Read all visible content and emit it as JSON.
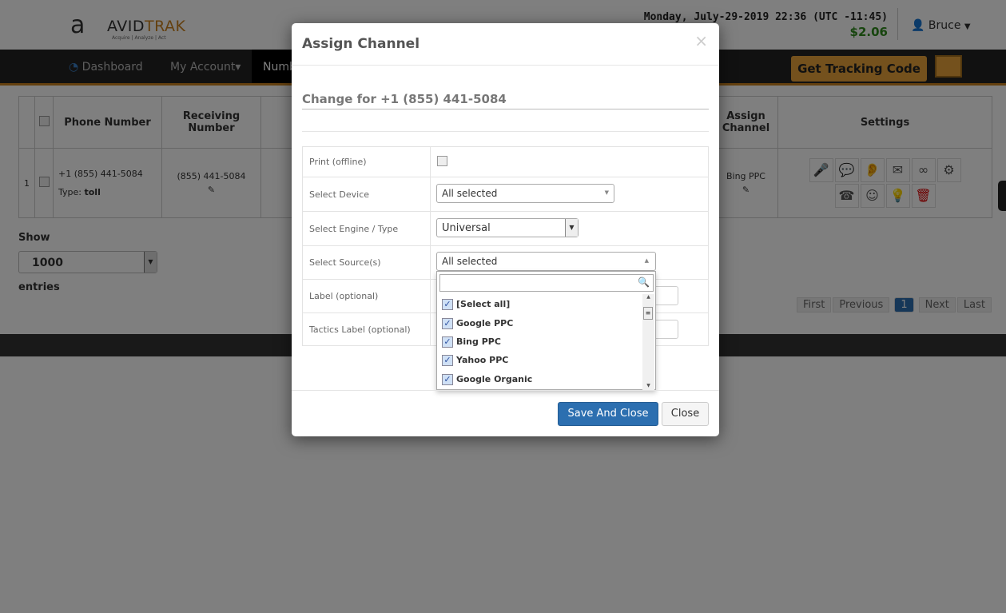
{
  "header": {
    "logo_mark": "a",
    "logo_text_a": "AVID",
    "logo_text_b": "TRAK",
    "tagline": "Acquire | Analyze | Act",
    "datetime": "Monday, July-29-2019 22:36 (UTC -11:45)",
    "balance": "$2.06",
    "user": "Bruce",
    "user_icon": "user-icon"
  },
  "nav": {
    "items": [
      "Dashboard",
      "My Account▾",
      "Numb"
    ],
    "tracking_button": "Get Tracking Code"
  },
  "table": {
    "headers": [
      "Phone Number",
      "Receiving Number",
      "Assign Channel",
      "Settings"
    ],
    "row": {
      "index": "1",
      "phone": "+1 (855) 441-5084",
      "type_label": "Type:",
      "type": "toll",
      "receiving": "(855) 441-5084",
      "channel": "Bing PPC"
    },
    "settings_icons": [
      "microphone-icon",
      "chat-icon",
      "ear-icon",
      "mail-icon",
      "voicemail-icon",
      "gears-icon",
      "caller-id-icon",
      "support-icon",
      "lightbulb-icon",
      "trash-icon"
    ]
  },
  "length": {
    "show": "Show",
    "value": "1000",
    "entries": "entries"
  },
  "pager": [
    "First",
    "Previous",
    "1",
    "Next",
    "Last"
  ],
  "modal": {
    "title": "Assign Channel",
    "close": "×",
    "change_for": "Change for +1 (855) 441-5084",
    "labels": [
      "Print (offline)",
      "Select Device",
      "Select Engine / Type",
      "Select Source(s)",
      "Label (optional)",
      "Tactics Label (optional)"
    ],
    "device": "All selected",
    "engine": "Universal",
    "sources": "All selected",
    "source_options": [
      "[Select all]",
      "Google PPC",
      "Bing PPC",
      "Yahoo PPC",
      "Google Organic"
    ],
    "save": "Save And Close",
    "close_btn": "Close"
  },
  "colors": {
    "accent": "#c8811f",
    "primary": "#2c6fb0",
    "balance": "#2f8a1d"
  }
}
